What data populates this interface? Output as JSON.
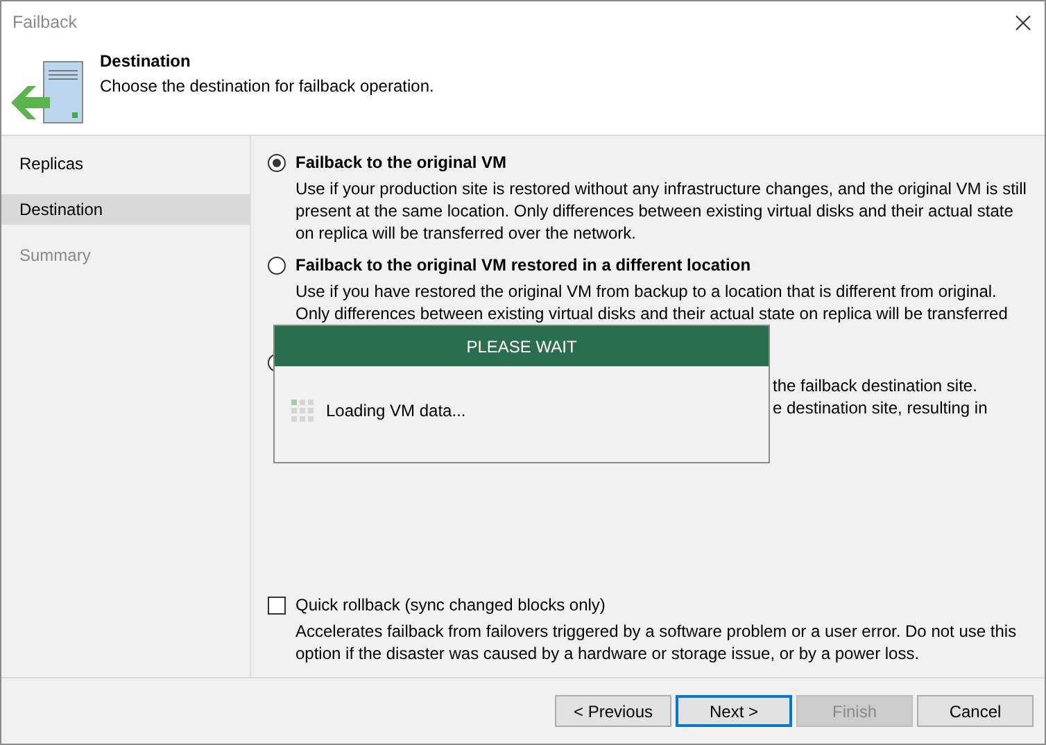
{
  "window": {
    "title": "Failback"
  },
  "header": {
    "title": "Destination",
    "subtitle": "Choose the destination for failback operation."
  },
  "steps": [
    {
      "label": "Replicas",
      "selected": false,
      "disabled": false
    },
    {
      "label": "Destination",
      "selected": true,
      "disabled": false
    },
    {
      "label": "Summary",
      "selected": false,
      "disabled": true
    }
  ],
  "options": [
    {
      "label": "Failback to the original VM",
      "selected": true,
      "lines": [
        "Use if your production site is restored without any infrastructure changes, and the original VM is still",
        "present at the same location.  Only differences between existing virtual disks and their actual state",
        "on replica will be transferred over the network."
      ]
    },
    {
      "label": "Failback to the original VM restored in a different location",
      "selected": false,
      "lines": [
        "Use if you have restored the original VM from backup to a location that is different from original.",
        "Only differences between existing virtual disks and their actual state on replica will be transferred"
      ]
    }
  ],
  "partial_option": {
    "selected": false,
    "lines": [
      "the failback destination site.",
      "e destination site, resulting in"
    ]
  },
  "quick_rollback": {
    "label": "Quick rollback (sync changed blocks only)",
    "checked": false,
    "lines": [
      "Accelerates failback from failovers triggered by a software problem or a user error. Do not use this",
      "option if the disaster was caused by a hardware or storage issue, or by a power loss."
    ]
  },
  "buttons": [
    {
      "label": "< Previous",
      "kind": "normal"
    },
    {
      "label": "Next >",
      "kind": "default"
    },
    {
      "label": "Finish",
      "kind": "disabled"
    },
    {
      "label": "Cancel",
      "kind": "normal"
    }
  ],
  "wait_dialog": {
    "title": "PLEASE WAIT",
    "message": "Loading VM data..."
  }
}
